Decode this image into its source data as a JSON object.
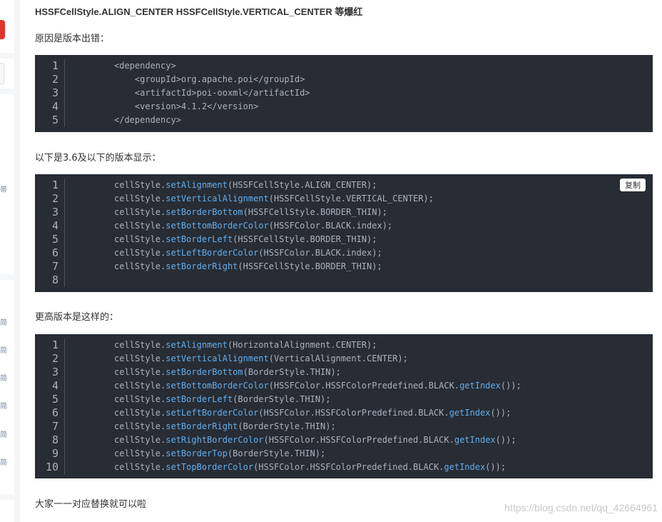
{
  "article": {
    "heading": "HSSFCellStyle.ALIGN_CENTER HSSFCellStyle.VERTICAL_CENTER 等爆红",
    "para1": "原因是版本出错：",
    "para2": "以下是3.6及以下的版本显示：",
    "para3": "更高版本是这样的：",
    "para4": "大家一一对应替换就可以啦"
  },
  "copy_label": "复制",
  "watermark": "https://blog.csdn.net/qq_42664961",
  "sidebar_glyphs": [
    "帯",
    "简",
    "简",
    "简",
    "简",
    "简",
    "简"
  ],
  "code1": [
    {
      "n": "1",
      "parts": [
        {
          "c": "t",
          "s": "<dependency>"
        }
      ]
    },
    {
      "n": "2",
      "parts": [
        {
          "c": "t",
          "s": "    <groupId>org.apache.poi</groupId>"
        }
      ]
    },
    {
      "n": "3",
      "parts": [
        {
          "c": "t",
          "s": "    <artifactId>poi-ooxml</artifactId>"
        }
      ]
    },
    {
      "n": "4",
      "parts": [
        {
          "c": "t",
          "s": "    <version>4.1.2</version>"
        }
      ]
    },
    {
      "n": "5",
      "parts": [
        {
          "c": "t",
          "s": "</dependency>"
        }
      ]
    }
  ],
  "code2": [
    {
      "n": "1",
      "parts": [
        {
          "c": "t",
          "s": "cellStyle."
        },
        {
          "c": "m",
          "s": "setAlignment"
        },
        {
          "c": "t",
          "s": "(HSSFCellStyle.ALIGN_CENTER);"
        }
      ]
    },
    {
      "n": "2",
      "parts": [
        {
          "c": "t",
          "s": "cellStyle."
        },
        {
          "c": "m",
          "s": "setVerticalAlignment"
        },
        {
          "c": "t",
          "s": "(HSSFCellStyle.VERTICAL_CENTER);"
        }
      ]
    },
    {
      "n": "3",
      "parts": [
        {
          "c": "t",
          "s": "cellStyle."
        },
        {
          "c": "m",
          "s": "setBorderBottom"
        },
        {
          "c": "t",
          "s": "(HSSFCellStyle.BORDER_THIN);"
        }
      ]
    },
    {
      "n": "4",
      "parts": [
        {
          "c": "t",
          "s": "cellStyle."
        },
        {
          "c": "m",
          "s": "setBottomBorderColor"
        },
        {
          "c": "t",
          "s": "(HSSFColor.BLACK.index);"
        }
      ]
    },
    {
      "n": "5",
      "parts": [
        {
          "c": "t",
          "s": "cellStyle."
        },
        {
          "c": "m",
          "s": "setBorderLeft"
        },
        {
          "c": "t",
          "s": "(HSSFCellStyle.BORDER_THIN);"
        }
      ]
    },
    {
      "n": "6",
      "parts": [
        {
          "c": "t",
          "s": "cellStyle."
        },
        {
          "c": "m",
          "s": "setLeftBorderColor"
        },
        {
          "c": "t",
          "s": "(HSSFColor.BLACK.index);"
        }
      ]
    },
    {
      "n": "7",
      "parts": [
        {
          "c": "t",
          "s": "cellStyle."
        },
        {
          "c": "m",
          "s": "setBorderRight"
        },
        {
          "c": "t",
          "s": "(HSSFCellStyle.BORDER_THIN);"
        }
      ]
    },
    {
      "n": "8",
      "parts": []
    }
  ],
  "code3": [
    {
      "n": "1",
      "parts": [
        {
          "c": "t",
          "s": "cellStyle."
        },
        {
          "c": "m",
          "s": "setAlignment"
        },
        {
          "c": "t",
          "s": "(HorizontalAlignment.CENTER);"
        }
      ]
    },
    {
      "n": "2",
      "parts": [
        {
          "c": "t",
          "s": "cellStyle."
        },
        {
          "c": "m",
          "s": "setVerticalAlignment"
        },
        {
          "c": "t",
          "s": "(VerticalAlignment.CENTER);"
        }
      ]
    },
    {
      "n": "3",
      "parts": [
        {
          "c": "t",
          "s": "cellStyle."
        },
        {
          "c": "m",
          "s": "setBorderBottom"
        },
        {
          "c": "t",
          "s": "(BorderStyle.THIN);"
        }
      ]
    },
    {
      "n": "4",
      "parts": [
        {
          "c": "t",
          "s": "cellStyle."
        },
        {
          "c": "m",
          "s": "setBottomBorderColor"
        },
        {
          "c": "t",
          "s": "(HSSFColor.HSSFColorPredefined.BLACK."
        },
        {
          "c": "m",
          "s": "getIndex"
        },
        {
          "c": "t",
          "s": "());"
        }
      ]
    },
    {
      "n": "5",
      "parts": [
        {
          "c": "t",
          "s": "cellStyle."
        },
        {
          "c": "m",
          "s": "setBorderLeft"
        },
        {
          "c": "t",
          "s": "(BorderStyle.THIN);"
        }
      ]
    },
    {
      "n": "6",
      "parts": [
        {
          "c": "t",
          "s": "cellStyle."
        },
        {
          "c": "m",
          "s": "setLeftBorderColor"
        },
        {
          "c": "t",
          "s": "(HSSFColor.HSSFColorPredefined.BLACK."
        },
        {
          "c": "m",
          "s": "getIndex"
        },
        {
          "c": "t",
          "s": "());"
        }
      ]
    },
    {
      "n": "7",
      "parts": [
        {
          "c": "t",
          "s": "cellStyle."
        },
        {
          "c": "m",
          "s": "setBorderRight"
        },
        {
          "c": "t",
          "s": "(BorderStyle.THIN);"
        }
      ]
    },
    {
      "n": "8",
      "parts": [
        {
          "c": "t",
          "s": "cellStyle."
        },
        {
          "c": "m",
          "s": "setRightBorderColor"
        },
        {
          "c": "t",
          "s": "(HSSFColor.HSSFColorPredefined.BLACK."
        },
        {
          "c": "m",
          "s": "getIndex"
        },
        {
          "c": "t",
          "s": "());"
        }
      ]
    },
    {
      "n": "9",
      "parts": [
        {
          "c": "t",
          "s": "cellStyle."
        },
        {
          "c": "m",
          "s": "setBorderTop"
        },
        {
          "c": "t",
          "s": "(BorderStyle.THIN);"
        }
      ]
    },
    {
      "n": "10",
      "parts": [
        {
          "c": "t",
          "s": "cellStyle."
        },
        {
          "c": "m",
          "s": "setTopBorderColor"
        },
        {
          "c": "t",
          "s": "(HSSFColor.HSSFColorPredefined.BLACK."
        },
        {
          "c": "m",
          "s": "getIndex"
        },
        {
          "c": "t",
          "s": "());"
        }
      ]
    }
  ],
  "colors": {
    "code_bg": "#282c34",
    "code_text": "#abb2bf",
    "method": "#61aeee",
    "sidebar_accent": "#e0342c"
  }
}
